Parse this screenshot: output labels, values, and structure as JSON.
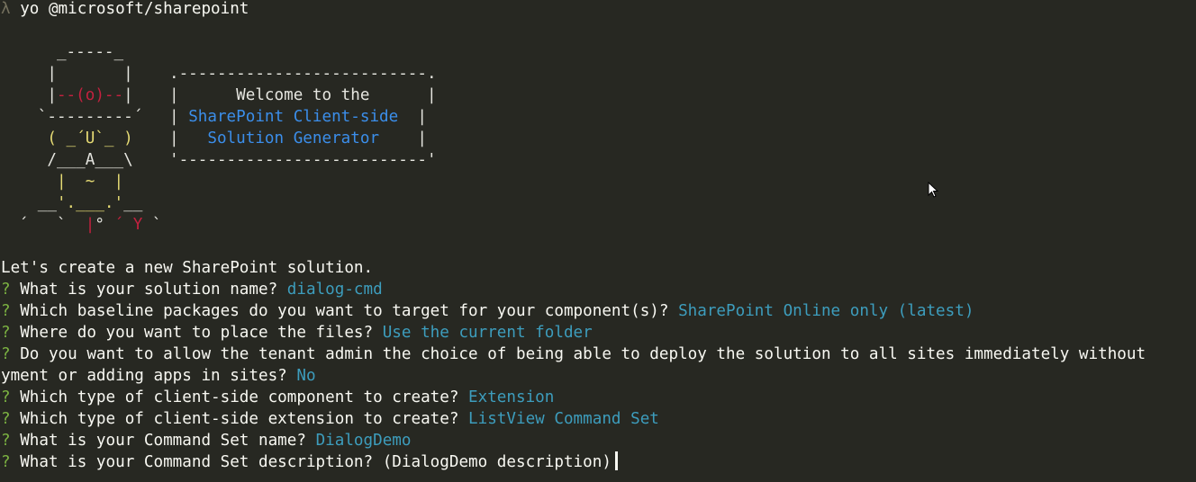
{
  "prompt": {
    "symbol": "λ",
    "command": "yo @microsoft/sharepoint"
  },
  "banner": {
    "welcome": "Welcome to the",
    "title_line1": "SharePoint Client-side",
    "title_line2": "Solution Generator"
  },
  "intro": "Let's create a new SharePoint solution.",
  "questions": [
    {
      "marker": "?",
      "question": "What is your solution name?",
      "answer": "dialog-cmd"
    },
    {
      "marker": "?",
      "question": "Which baseline packages do you want to target for your component(s)?",
      "answer": "SharePoint Online only (latest)"
    },
    {
      "marker": "?",
      "question": "Where do you want to place the files?",
      "answer": "Use the current folder"
    },
    {
      "marker": "?",
      "question": "Do you want to allow the tenant admin the choice of being able to deploy the solution to all sites immediately without",
      "answer": ""
    },
    {
      "marker": "",
      "question": "yment or adding apps in sites?",
      "answer": "No"
    },
    {
      "marker": "?",
      "question": "Which type of client-side component to create?",
      "answer": "Extension"
    },
    {
      "marker": "?",
      "question": "Which type of client-side extension to create?",
      "answer": "ListView Command Set"
    },
    {
      "marker": "?",
      "question": "What is your Command Set name?",
      "answer": "DialogDemo"
    },
    {
      "marker": "?",
      "question": "What is your Command Set description?",
      "answer": "(DialogDemo description)"
    }
  ],
  "colors": {
    "background": "#272822",
    "question_marker": "#7cb342",
    "answer": "#3d9dbd",
    "banner_blue": "#3b8eea",
    "logo_red": "#c4213f",
    "logo_yellow": "#e6db74"
  }
}
